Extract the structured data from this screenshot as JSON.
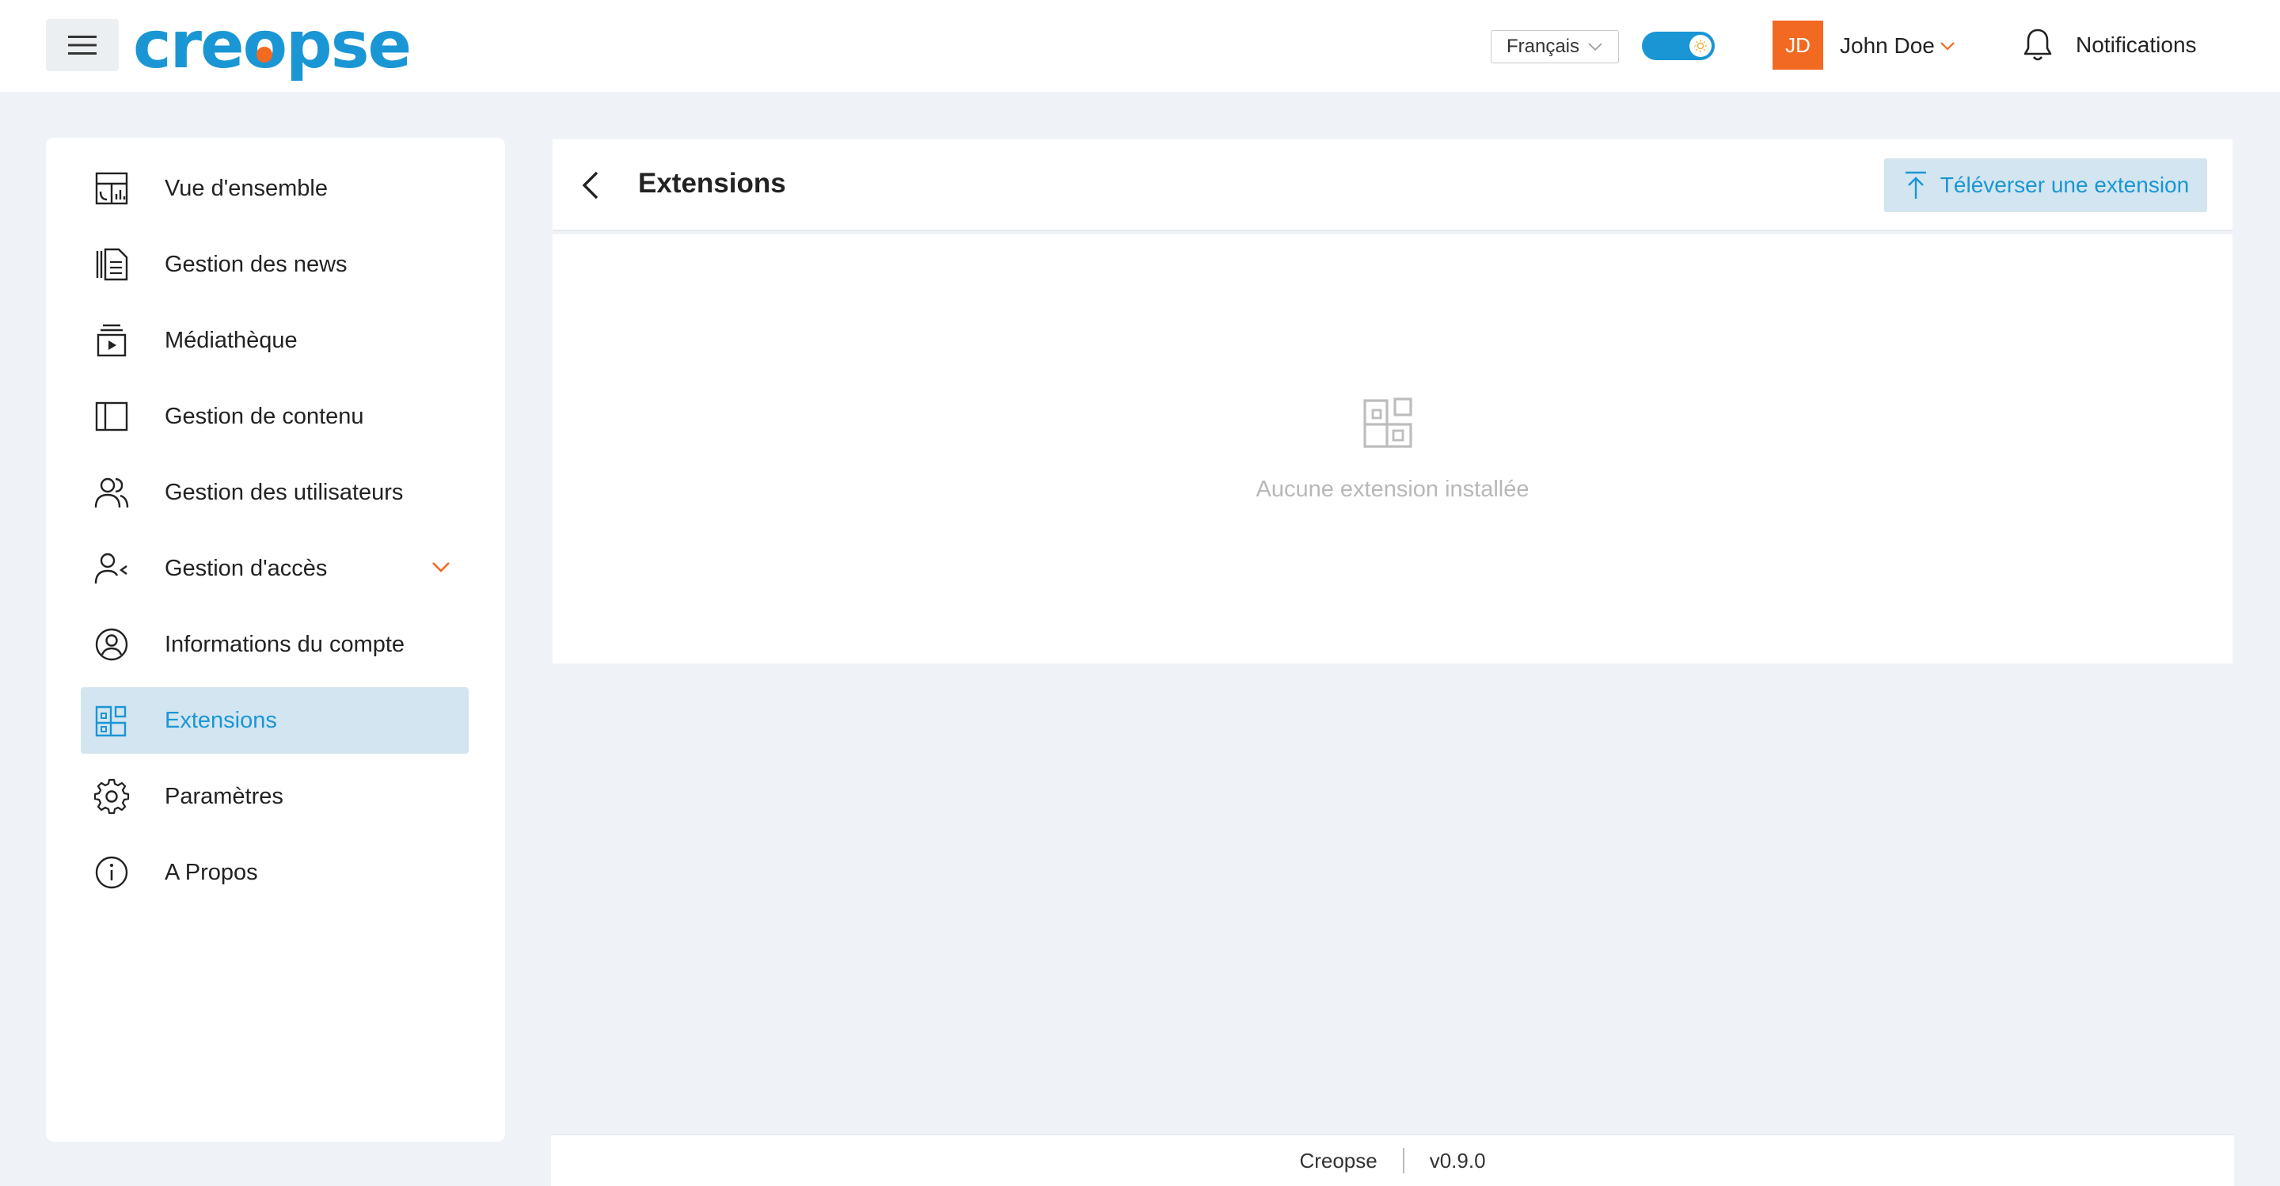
{
  "header": {
    "logo_text": "creopse",
    "language": "Français",
    "theme_toggle_on": true,
    "user": {
      "initials": "JD",
      "name": "John Doe"
    },
    "notifications_label": "Notifications"
  },
  "sidebar": {
    "items": [
      {
        "label": "Vue d'ensemble",
        "icon": "dashboard-icon"
      },
      {
        "label": "Gestion des news",
        "icon": "news-icon"
      },
      {
        "label": "Médiathèque",
        "icon": "media-library-icon"
      },
      {
        "label": "Gestion de contenu",
        "icon": "content-layout-icon"
      },
      {
        "label": "Gestion des utilisateurs",
        "icon": "users-icon"
      },
      {
        "label": "Gestion d'accès",
        "icon": "user-access-icon",
        "has_submenu": true
      },
      {
        "label": "Informations du compte",
        "icon": "account-circle-icon"
      },
      {
        "label": "Extensions",
        "icon": "extensions-icon",
        "active": true
      },
      {
        "label": "Paramètres",
        "icon": "gear-icon"
      },
      {
        "label": "A Propos",
        "icon": "info-icon"
      }
    ]
  },
  "main": {
    "title": "Extensions",
    "upload_button": "Téléverser une extension",
    "empty_message": "Aucune extension installée"
  },
  "footer": {
    "brand": "Creopse",
    "version": "v0.9.0"
  },
  "colors": {
    "accent": "#1a96d4",
    "brand_orange": "#f26a21",
    "active_bg": "#d3e5f0",
    "page_bg": "#eff3f8"
  }
}
